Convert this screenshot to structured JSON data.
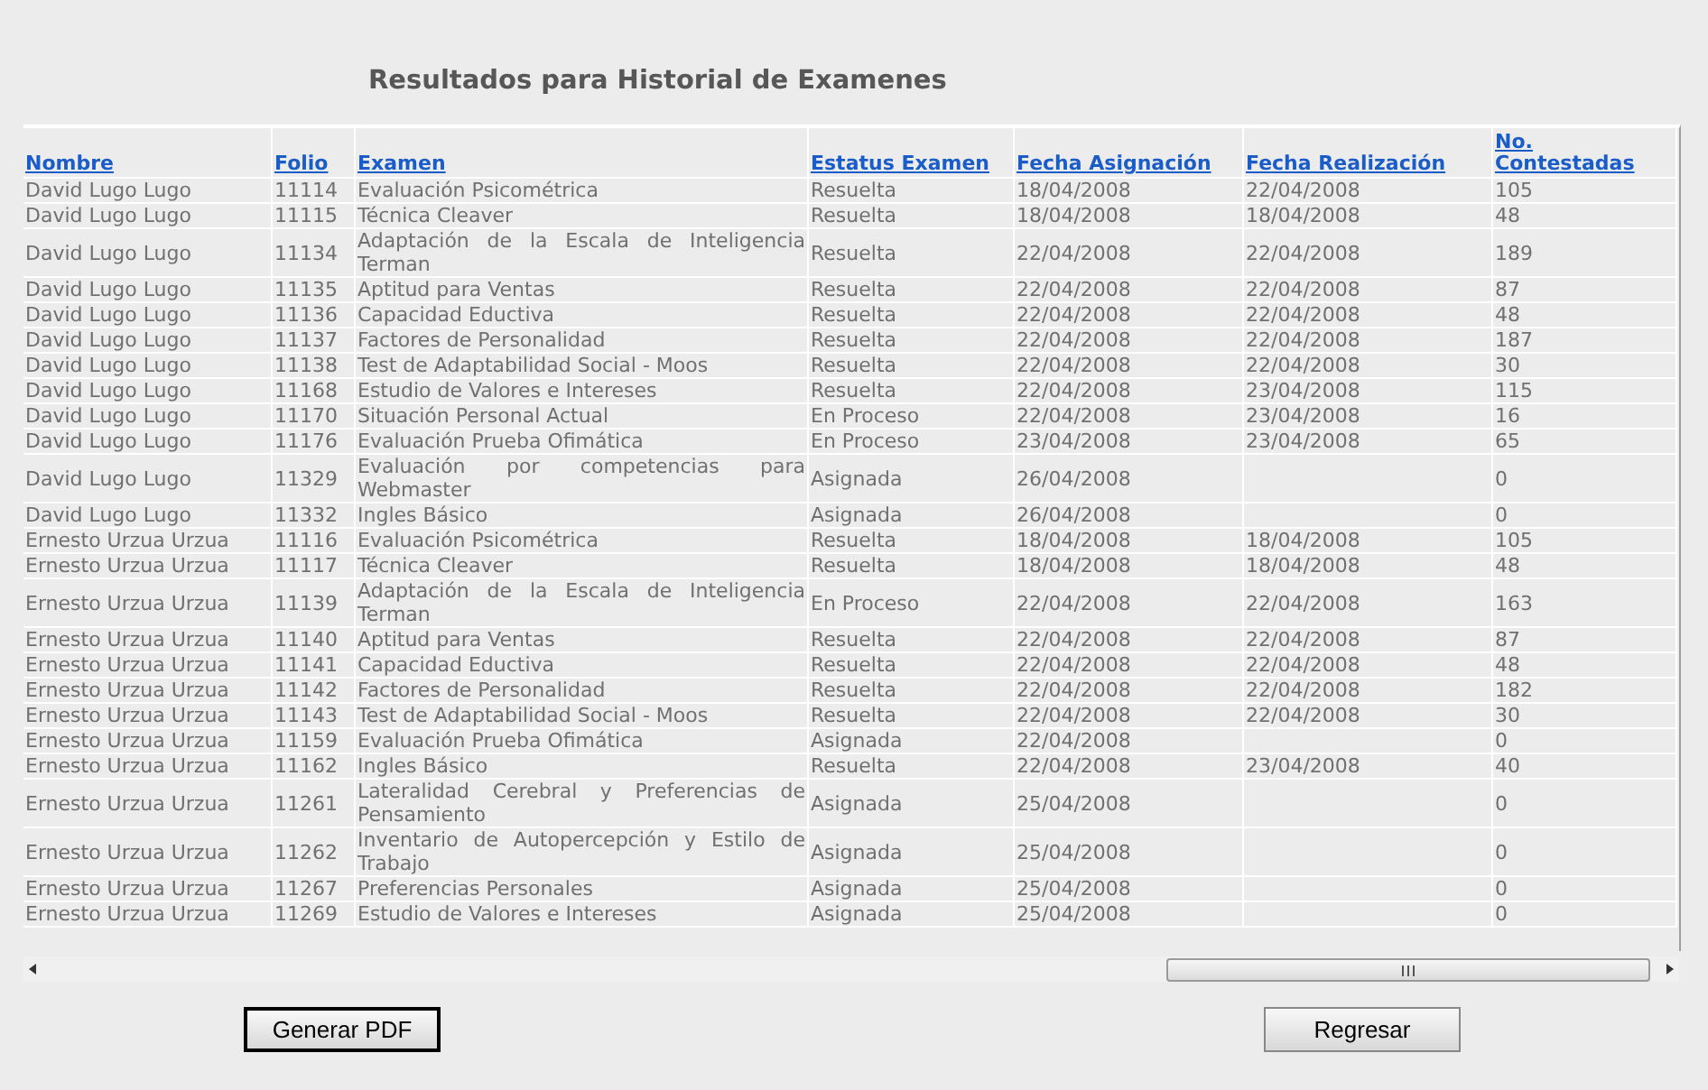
{
  "title": "Resultados para Historial de Examenes",
  "table": {
    "columns": [
      "Nombre",
      "Folio",
      "Examen",
      "Estatus Examen",
      "Fecha Asignación",
      "Fecha Realización",
      "No. Contestadas"
    ],
    "rows": [
      {
        "nombre": "David Lugo Lugo",
        "folio": "11114",
        "examen": "Evaluación Psicométrica",
        "estatus": "Resuelta",
        "fecha_asignacion": "18/04/2008",
        "fecha_realizacion": "22/04/2008",
        "contestadas": "105"
      },
      {
        "nombre": "David Lugo Lugo",
        "folio": "11115",
        "examen": "Técnica Cleaver",
        "estatus": "Resuelta",
        "fecha_asignacion": "18/04/2008",
        "fecha_realizacion": "18/04/2008",
        "contestadas": "48"
      },
      {
        "nombre": "David Lugo Lugo",
        "folio": "11134",
        "examen": "Adaptación de la Escala de Inteligencia Terman",
        "estatus": "Resuelta",
        "fecha_asignacion": "22/04/2008",
        "fecha_realizacion": "22/04/2008",
        "contestadas": "189"
      },
      {
        "nombre": "David Lugo Lugo",
        "folio": "11135",
        "examen": "Aptitud para Ventas",
        "estatus": "Resuelta",
        "fecha_asignacion": "22/04/2008",
        "fecha_realizacion": "22/04/2008",
        "contestadas": "87"
      },
      {
        "nombre": "David Lugo Lugo",
        "folio": "11136",
        "examen": "Capacidad Eductiva",
        "estatus": "Resuelta",
        "fecha_asignacion": "22/04/2008",
        "fecha_realizacion": "22/04/2008",
        "contestadas": "48"
      },
      {
        "nombre": "David Lugo Lugo",
        "folio": "11137",
        "examen": "Factores de Personalidad",
        "estatus": "Resuelta",
        "fecha_asignacion": "22/04/2008",
        "fecha_realizacion": "22/04/2008",
        "contestadas": "187"
      },
      {
        "nombre": "David Lugo Lugo",
        "folio": "11138",
        "examen": "Test de Adaptabilidad Social - Moos",
        "estatus": "Resuelta",
        "fecha_asignacion": "22/04/2008",
        "fecha_realizacion": "22/04/2008",
        "contestadas": "30"
      },
      {
        "nombre": "David Lugo Lugo",
        "folio": "11168",
        "examen": "Estudio de Valores e Intereses",
        "estatus": "Resuelta",
        "fecha_asignacion": "22/04/2008",
        "fecha_realizacion": "23/04/2008",
        "contestadas": "115"
      },
      {
        "nombre": "David Lugo Lugo",
        "folio": "11170",
        "examen": "Situación Personal Actual",
        "estatus": "En Proceso",
        "fecha_asignacion": "22/04/2008",
        "fecha_realizacion": "23/04/2008",
        "contestadas": "16"
      },
      {
        "nombre": "David Lugo Lugo",
        "folio": "11176",
        "examen": "Evaluación Prueba Ofimática",
        "estatus": "En Proceso",
        "fecha_asignacion": "23/04/2008",
        "fecha_realizacion": "23/04/2008",
        "contestadas": "65"
      },
      {
        "nombre": "David Lugo Lugo",
        "folio": "11329",
        "examen": "Evaluación por competencias para Webmaster",
        "estatus": "Asignada",
        "fecha_asignacion": "26/04/2008",
        "contestadas": "0"
      },
      {
        "nombre": "David Lugo Lugo",
        "folio": "11332",
        "examen": "Ingles Básico",
        "estatus": "Asignada",
        "fecha_asignacion": "26/04/2008",
        "contestadas": "0"
      },
      {
        "nombre": "Ernesto Urzua Urzua",
        "folio": "11116",
        "examen": "Evaluación Psicométrica",
        "estatus": "Resuelta",
        "fecha_asignacion": "18/04/2008",
        "fecha_realizacion": "18/04/2008",
        "contestadas": "105"
      },
      {
        "nombre": "Ernesto Urzua Urzua",
        "folio": "11117",
        "examen": "Técnica Cleaver",
        "estatus": "Resuelta",
        "fecha_asignacion": "18/04/2008",
        "fecha_realizacion": "18/04/2008",
        "contestadas": "48"
      },
      {
        "nombre": "Ernesto Urzua Urzua",
        "folio": "11139",
        "examen": "Adaptación de la Escala de Inteligencia Terman",
        "estatus": "En Proceso",
        "fecha_asignacion": "22/04/2008",
        "fecha_realizacion": "22/04/2008",
        "contestadas": "163"
      },
      {
        "nombre": "Ernesto Urzua Urzua",
        "folio": "11140",
        "examen": "Aptitud para Ventas",
        "estatus": "Resuelta",
        "fecha_asignacion": "22/04/2008",
        "fecha_realizacion": "22/04/2008",
        "contestadas": "87"
      },
      {
        "nombre": "Ernesto Urzua Urzua",
        "folio": "11141",
        "examen": "Capacidad Eductiva",
        "estatus": "Resuelta",
        "fecha_asignacion": "22/04/2008",
        "fecha_realizacion": "22/04/2008",
        "contestadas": "48"
      },
      {
        "nombre": "Ernesto Urzua Urzua",
        "folio": "11142",
        "examen": "Factores de Personalidad",
        "estatus": "Resuelta",
        "fecha_asignacion": "22/04/2008",
        "fecha_realizacion": "22/04/2008",
        "contestadas": "182"
      },
      {
        "nombre": "Ernesto Urzua Urzua",
        "folio": "11143",
        "examen": "Test de Adaptabilidad Social - Moos",
        "estatus": "Resuelta",
        "fecha_asignacion": "22/04/2008",
        "fecha_realizacion": "22/04/2008",
        "contestadas": "30"
      },
      {
        "nombre": "Ernesto Urzua Urzua",
        "folio": "11159",
        "examen": "Evaluación Prueba Ofimática",
        "estatus": "Asignada",
        "fecha_asignacion": "22/04/2008",
        "contestadas": "0"
      },
      {
        "nombre": "Ernesto Urzua Urzua",
        "folio": "11162",
        "examen": "Ingles Básico",
        "estatus": "Resuelta",
        "fecha_asignacion": "22/04/2008",
        "fecha_realizacion": "23/04/2008",
        "contestadas": "40"
      },
      {
        "nombre": "Ernesto Urzua Urzua",
        "folio": "11261",
        "examen": "Lateralidad Cerebral y Preferencias de Pensamiento",
        "estatus": "Asignada",
        "fecha_asignacion": "25/04/2008",
        "contestadas": "0"
      },
      {
        "nombre": "Ernesto Urzua Urzua",
        "folio": "11262",
        "examen": "Inventario de Autopercepción y Estilo de Trabajo",
        "estatus": "Asignada",
        "fecha_asignacion": "25/04/2008",
        "contestadas": "0"
      },
      {
        "nombre": "Ernesto Urzua Urzua",
        "folio": "11267",
        "examen": "Preferencias Personales",
        "estatus": "Asignada",
        "fecha_asignacion": "25/04/2008",
        "contestadas": "0"
      },
      {
        "nombre": "Ernesto Urzua Urzua",
        "folio": "11269",
        "examen": "Estudio de Valores e Intereses",
        "estatus": "Asignada",
        "fecha_asignacion": "25/04/2008",
        "contestadas": "0"
      }
    ]
  },
  "buttons": [
    "Generar PDF",
    "Regresar"
  ]
}
